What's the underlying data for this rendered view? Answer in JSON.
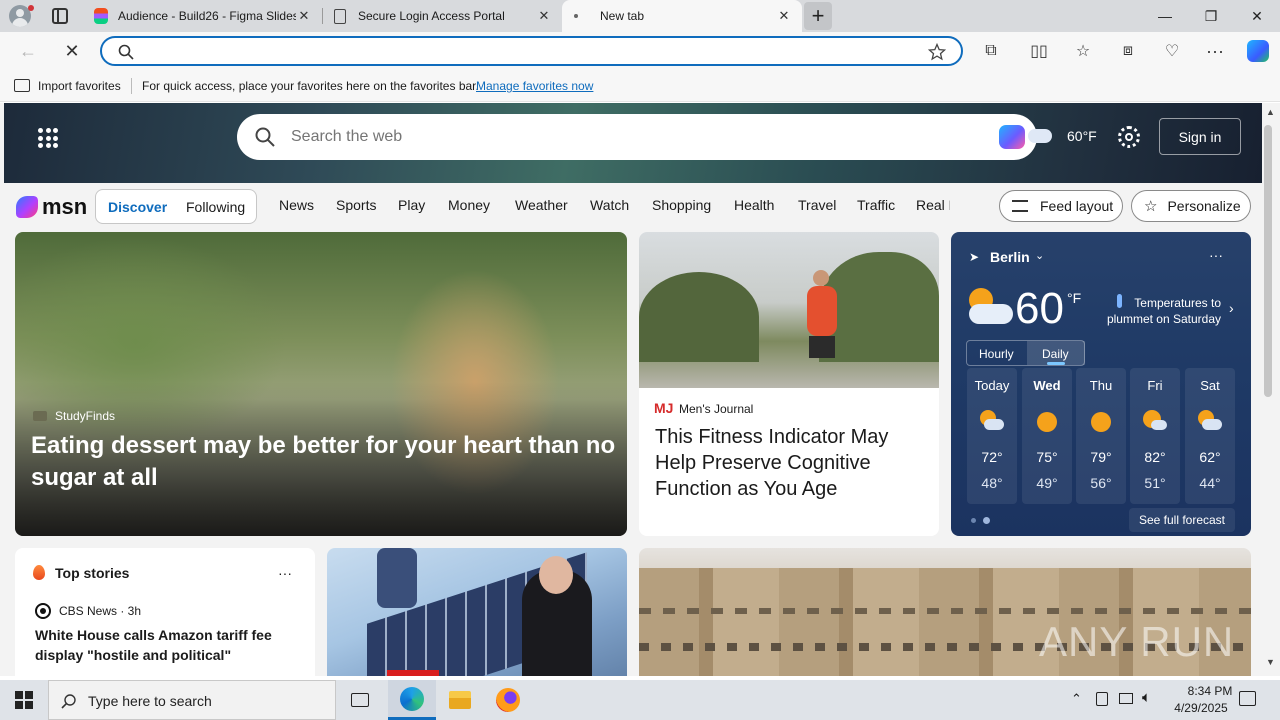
{
  "tabs": [
    {
      "title": "Audience - Build26 - Figma Slides",
      "close": "✕"
    },
    {
      "title": "Secure Login Access Portal",
      "close": "✕"
    },
    {
      "title": "New tab",
      "close": "✕"
    }
  ],
  "new_tab_symbol": "+",
  "window_controls": {
    "minimize": "—",
    "restore": "❐",
    "close": "✕"
  },
  "address_bar": {
    "value": "",
    "placeholder": ""
  },
  "favorites_bar": {
    "import_label": "Import favorites",
    "message": "For quick access, place your favorites here on the favorites bar.",
    "manage_link": "Manage favorites now"
  },
  "msn": {
    "search_placeholder": "Search the web",
    "temperature_small": "60°F",
    "sign_in": "Sign in",
    "logo_text": "msn",
    "segments": [
      "Discover",
      "Following"
    ],
    "nav_items": [
      "News",
      "Sports",
      "Play",
      "Money",
      "Weather",
      "Watch",
      "Shopping",
      "Health",
      "Travel",
      "Traffic",
      "Real E"
    ],
    "feed_layout": "Feed layout",
    "personalize": "Personalize"
  },
  "main_story": {
    "source": "StudyFinds",
    "headline": "Eating dessert may be better for your heart than no sugar at all"
  },
  "fitness_story": {
    "source_logo": "MJ",
    "source": "Men's Journal",
    "headline": "This Fitness Indicator May Help Preserve Cognitive Function as You Age"
  },
  "weather": {
    "city": "Berlin",
    "temp": "60",
    "unit": "°F",
    "alert": "Temperatures to plummet on Saturday",
    "tabs": [
      "Hourly",
      "Daily"
    ],
    "days": [
      {
        "name": "Today",
        "hi": "72°",
        "lo": "48°",
        "icon": "partly-sunny-icon"
      },
      {
        "name": "Wed",
        "hi": "75°",
        "lo": "49°",
        "icon": "sun-icon"
      },
      {
        "name": "Thu",
        "hi": "79°",
        "lo": "56°",
        "icon": "sun-icon"
      },
      {
        "name": "Fri",
        "hi": "82°",
        "lo": "51°",
        "icon": "partly-sunny-icon"
      },
      {
        "name": "Sat",
        "hi": "62°",
        "lo": "44°",
        "icon": "partly-sunny-icon"
      }
    ],
    "see_full": "See full forecast"
  },
  "top_stories": {
    "title": "Top stories",
    "more": "···",
    "source": "CBS News · 3h",
    "headline": "White House calls Amazon tariff fee display \"hostile and political\""
  },
  "watermark": "ANY RUN",
  "taskbar": {
    "search_placeholder": "Type here to search",
    "time": "8:34 PM",
    "date": "4/29/2025"
  },
  "colors": {
    "accent": "#0f6cbd",
    "weather_bg": "#1f3a66"
  }
}
